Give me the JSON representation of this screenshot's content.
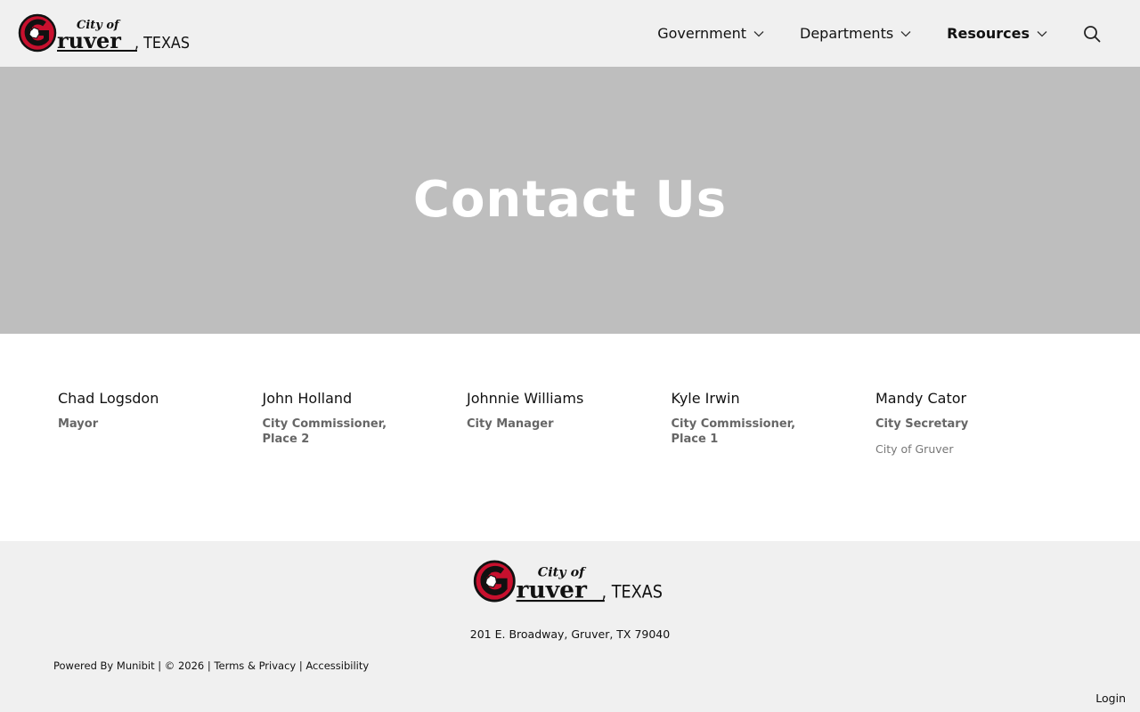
{
  "brand": {
    "logo_city_of": "City of",
    "logo_gruver": "ruver",
    "logo_texas": ", TEXAS"
  },
  "nav": {
    "items": [
      {
        "label": "Government"
      },
      {
        "label": "Departments"
      },
      {
        "label": "Resources"
      }
    ]
  },
  "hero": {
    "title": "Contact Us"
  },
  "contacts": [
    {
      "name": "Chad Logsdon",
      "title": "Mayor"
    },
    {
      "name": "John Holland",
      "title": "City Commissioner, Place 2"
    },
    {
      "name": "Johnnie Williams",
      "title": "City Manager"
    },
    {
      "name": "Kyle Irwin",
      "title": "City Commissioner, Place 1"
    },
    {
      "name": "Mandy Cator",
      "title": "City Secretary",
      "org": "City of Gruver"
    }
  ],
  "footer": {
    "address": "201 E. Broadway, Gruver, TX 79040",
    "powered_by": "Powered By Munibit",
    "copyright": "© 2026",
    "terms": "Terms & Privacy",
    "accessibility": "Accessibility",
    "login": "Login"
  },
  "colors": {
    "header_bg": "#f0f0f0",
    "hero_bg": "#bebebe",
    "logo_red": "#c8102e"
  }
}
